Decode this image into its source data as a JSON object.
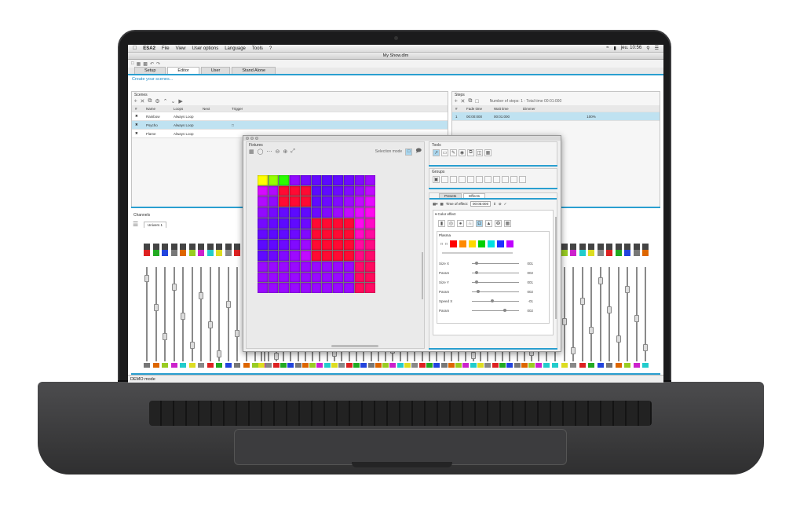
{
  "menubar": {
    "app": "ESA2",
    "items": [
      "File",
      "View",
      "User options",
      "Language",
      "Tools",
      "?"
    ],
    "clock": "jeu. 10:56"
  },
  "window": {
    "title": "My Show.dlm"
  },
  "tabs": [
    "Setup",
    "Editor",
    "User",
    "Stand Alone"
  ],
  "active_tab": "Editor",
  "hint": "Create your scenes...",
  "scenes": {
    "title": "Scenes",
    "columns": [
      "#",
      "Name",
      "Loops",
      "Next",
      "Trigger"
    ],
    "rows": [
      {
        "name": "Rainbow",
        "loops": "Always Loop"
      },
      {
        "name": "Psycho",
        "loops": "Always Loop"
      },
      {
        "name": "Flame",
        "loops": "Always Loop"
      }
    ]
  },
  "steps": {
    "title": "Steps",
    "summary": "Number of steps: 1 - Total time 00:01:000",
    "columns": [
      "#",
      "Fade time",
      "Wait time",
      "Dimmer"
    ],
    "row": {
      "index": "1",
      "fade": "00:00:000",
      "wait": "00:01:000",
      "dimmer": "100%"
    }
  },
  "channels": {
    "title": "Channels",
    "universe": "Univers 1"
  },
  "dialog": {
    "fixtures_title": "Fixtures",
    "selection_mode": "Selection mode",
    "tools_title": "Tools",
    "groups_title": "Groups",
    "tabs": [
      "Presets",
      "Effects"
    ],
    "time_label": "Time of effect:",
    "time_value": "00:05:000",
    "color_effect": "Color effect",
    "plasma": "Plasma",
    "params": [
      {
        "label": "Size X",
        "value": "001"
      },
      {
        "label": "Param",
        "value": "002"
      },
      {
        "label": "Size Y",
        "value": "001"
      },
      {
        "label": "Param",
        "value": "002"
      },
      {
        "label": "Speed X",
        "value": "-01"
      },
      {
        "label": "Param",
        "value": "002"
      }
    ],
    "param_levels": [
      0.08,
      0.08,
      0.08,
      0.1,
      0.42,
      0.71
    ],
    "palette": [
      "#ff0000",
      "#ff8a00",
      "#ffd800",
      "#00d000",
      "#00e0e0",
      "#2030ff",
      "#c000ff"
    ]
  },
  "status": "DEMO mode"
}
